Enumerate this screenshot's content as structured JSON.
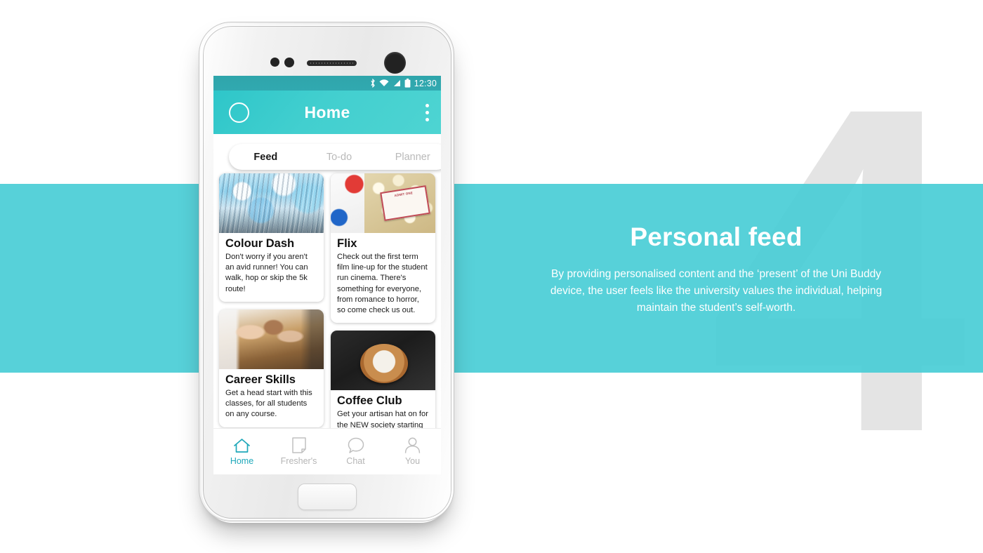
{
  "phone": {
    "status_bar": {
      "time": "12:30",
      "icons": [
        "bluetooth-icon",
        "wifi-icon",
        "signal-icon",
        "battery-icon"
      ]
    },
    "app_bar": {
      "title": "Home",
      "avatar": "profile-avatar",
      "overflow": "overflow-menu-icon"
    },
    "tabs": [
      {
        "label": "Feed",
        "active": true
      },
      {
        "label": "To-do",
        "active": false
      },
      {
        "label": "Planner",
        "active": false
      }
    ],
    "feed": {
      "left_column": [
        {
          "title": "Colour Dash",
          "description": "Don't worry if you aren't an avid runner! You can walk, hop or skip the 5k route!",
          "image": "colour-run-crowd-photo"
        },
        {
          "title": "Career Skills",
          "description": "Get a head start with this classes, for all students on any course.",
          "image": "fist-bump-desk-photo"
        },
        {
          "title": "",
          "description": "",
          "image": "warm-tone-partial-photo"
        }
      ],
      "right_column": [
        {
          "title": "Flix",
          "description": "Check out the first term film line-up for the student run cinema. There's something for everyone, from romance to horror, so come check us out.",
          "image": "popcorn-admit-one-ticket-photo",
          "ticket_text": "ADMIT ONE"
        },
        {
          "title": "Coffee Club",
          "description": "Get your artisan hat on for the NEW society starting this year for",
          "image": "latte-art-pour-photo"
        }
      ]
    },
    "bottom_nav": [
      {
        "label": "Home",
        "icon": "home-icon",
        "active": true
      },
      {
        "label": "Fresher's",
        "icon": "document-icon",
        "active": false
      },
      {
        "label": "Chat",
        "icon": "speech-bubble-icon",
        "active": false
      },
      {
        "label": "You",
        "icon": "person-icon",
        "active": false
      }
    ]
  },
  "callout": {
    "number": "4",
    "title": "Personal feed",
    "body": "By providing personalised content and the ‘present’ of the Uni Buddy device, the user feels like the university values the individual, helping maintain the student’s self-worth."
  },
  "colors": {
    "band_teal": "#4ACED6",
    "header_teal": "#42CFCF",
    "status_teal": "#31A9B0",
    "accent": "#1FA8BA",
    "watermark_gray": "#E4E4E4"
  }
}
